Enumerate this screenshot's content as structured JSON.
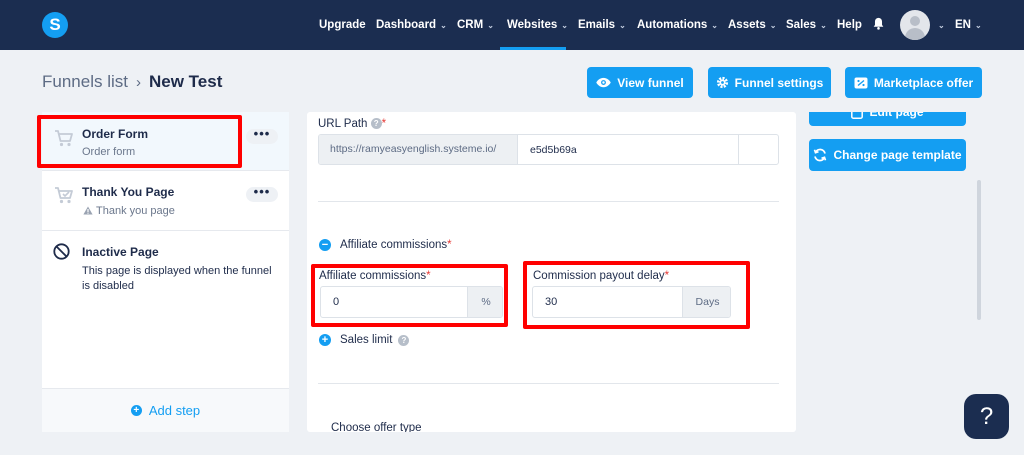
{
  "nav": {
    "logo": "S",
    "items": [
      {
        "label": "Upgrade",
        "chevron": false
      },
      {
        "label": "Dashboard",
        "chevron": true
      },
      {
        "label": "CRM",
        "chevron": true
      },
      {
        "label": "Websites",
        "chevron": true,
        "active": true
      },
      {
        "label": "Emails",
        "chevron": true
      },
      {
        "label": "Automations",
        "chevron": true
      },
      {
        "label": "Assets",
        "chevron": true
      },
      {
        "label": "Sales",
        "chevron": true
      },
      {
        "label": "Help",
        "chevron": false
      }
    ],
    "chevron_glyph": "⌄",
    "language": "EN",
    "accent": "#149ef2",
    "background": "#1b2d50"
  },
  "breadcrumb": {
    "parent": "Funnels list",
    "separator": "›",
    "current": "New Test"
  },
  "header_buttons": {
    "view_funnel": "View funnel",
    "funnel_settings": "Funnel settings",
    "marketplace_offer": "Marketplace offer"
  },
  "steps": [
    {
      "title": "Order Form",
      "subtitle": "Order form",
      "icon": "cart-icon"
    },
    {
      "title": "Thank You Page",
      "subtitle": "Thank you page",
      "icon": "cart-check-icon"
    },
    {
      "title": "Inactive Page",
      "subtitle": "This page is displayed when the funnel is disabled",
      "icon": "ban-icon"
    }
  ],
  "step_menu_glyph": "•••",
  "add_step": {
    "label": "Add step",
    "plus": "+"
  },
  "form": {
    "url_path": {
      "label": "URL Path",
      "required": "*",
      "help": "?",
      "prefix": "https://ramyeasyenglish.systeme.io/",
      "value": "e5d5b69a"
    },
    "affiliate_section": {
      "toggle": "−",
      "label": "Affiliate commissions",
      "required": "*"
    },
    "affiliate_commissions": {
      "label": "Affiliate commissions",
      "required": "*",
      "value": "0",
      "addon": "%"
    },
    "payout_delay": {
      "label": "Commission payout delay",
      "required": "*",
      "value": "30",
      "addon": "Days"
    },
    "sales_limit": {
      "toggle": "+",
      "label": "Sales limit",
      "help": "?"
    },
    "offer_type": {
      "label": "Choose offer type"
    }
  },
  "right_buttons": {
    "edit_page": "Edit page",
    "change_template": "Change page template"
  },
  "help_fab": "?"
}
